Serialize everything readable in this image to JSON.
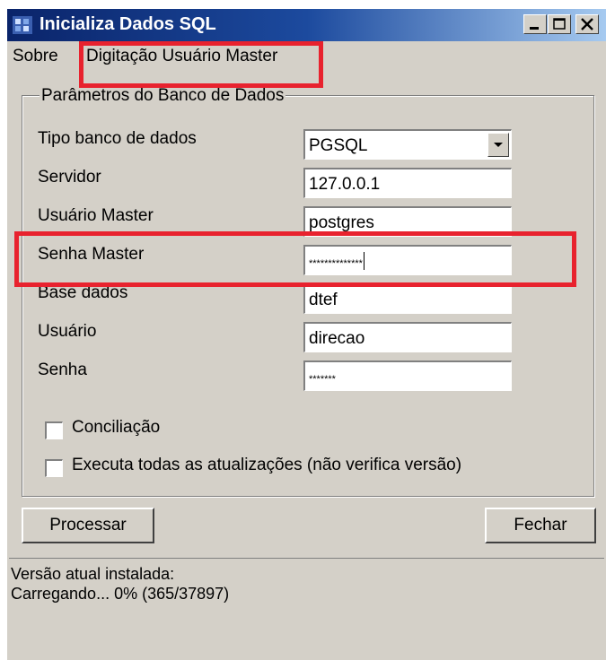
{
  "window": {
    "title": "Inicializa Dados SQL"
  },
  "menu": {
    "sobre": "Sobre",
    "digitacao": "Digitação Usuário Master"
  },
  "group": {
    "title": "Parâmetros do Banco de Dados",
    "fields": [
      {
        "label": "Tipo banco de dados",
        "value": "PGSQL"
      },
      {
        "label": "Servidor",
        "value": "127.0.0.1"
      },
      {
        "label": "Usuário Master",
        "value": "postgres"
      },
      {
        "label": "Senha Master",
        "value": "**************"
      },
      {
        "label": "Base dados",
        "value": "dtef"
      },
      {
        "label": "Usuário",
        "value": "direcao"
      },
      {
        "label": "Senha",
        "value": "*******"
      }
    ],
    "checkboxes": [
      {
        "label": "Conciliação",
        "checked": false
      },
      {
        "label": "Executa todas as atualizações (não verifica versão)",
        "checked": false
      }
    ]
  },
  "buttons": {
    "processar": "Processar",
    "fechar": "Fechar"
  },
  "status": {
    "line1": "Versão atual instalada:",
    "line2": "Carregando... 0% (365/37897)"
  },
  "colors": {
    "titlebar_start": "#0a246a",
    "titlebar_end": "#a6caf0",
    "highlight": "#e8222e",
    "face": "#d4d0c8"
  }
}
